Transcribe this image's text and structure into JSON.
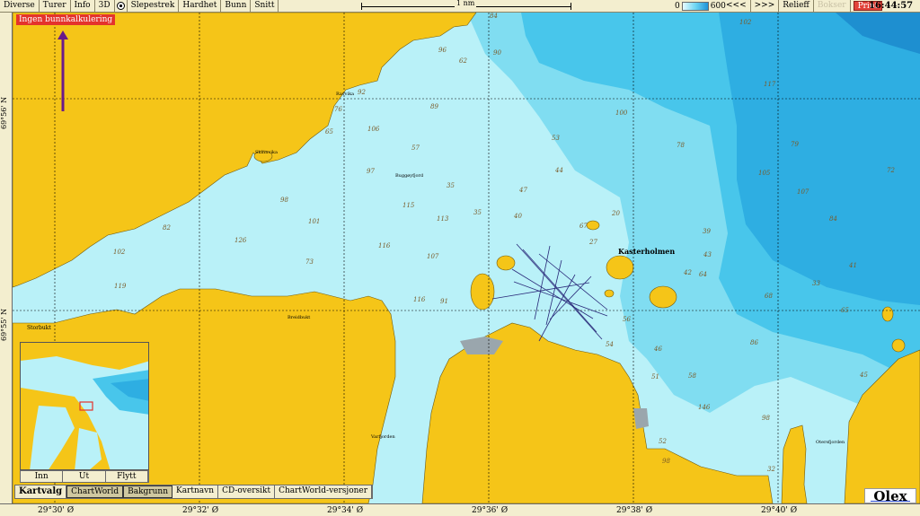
{
  "menu": {
    "items": [
      "Diverse",
      "Turer",
      "Info",
      "3D",
      "Slepestrek",
      "Hardhet",
      "Bunn",
      "Snitt"
    ]
  },
  "scale": {
    "label": "1 nm"
  },
  "depth_legend": {
    "min": "0",
    "max": "600"
  },
  "right_toolbar": {
    "prev": "<<<",
    "next": ">>>",
    "relieff": "Relieff",
    "boxes": "Bokser",
    "print": "Print"
  },
  "clock": "16:44:57",
  "warning": "Ingen bunnkalkulering",
  "latitudes": [
    "69°56' N",
    "69°55' N"
  ],
  "longitudes": [
    "29°30' Ø",
    "29°32' Ø",
    "29°34' Ø",
    "29°36' Ø",
    "29°38' Ø",
    "29°40' Ø"
  ],
  "place_names": {
    "kasterholmen": "Kasterholmen",
    "storbukt": "Storbukt",
    "skinnvika": "Skinnvika",
    "breidbukt": "Breidbukt",
    "ravvika": "Ravvika",
    "buggyfjord": "Buggøyfjord",
    "vartadjorden": "Varfjorden",
    "otersfjorden": "Otersfjorden"
  },
  "depths": [
    "84",
    "92",
    "90",
    "102",
    "76",
    "62",
    "106",
    "96",
    "117",
    "89",
    "98",
    "65",
    "57",
    "53",
    "79",
    "100",
    "97",
    "35",
    "78",
    "105",
    "107",
    "82",
    "115",
    "113",
    "101",
    "126",
    "116",
    "107",
    "47",
    "73",
    "40",
    "116",
    "91",
    "119",
    "102",
    "35",
    "44",
    "43",
    "42",
    "68",
    "64",
    "46",
    "58",
    "56",
    "51",
    "86",
    "146",
    "98",
    "52",
    "54",
    "67",
    "27",
    "20",
    "39",
    "41",
    "33",
    "45",
    "65",
    "32",
    "98",
    "72",
    "84"
  ],
  "minimap": {
    "buttons": [
      "Inn",
      "Ut",
      "Flytt"
    ]
  },
  "chart_bar": {
    "title": "Kartvalg",
    "buttons": [
      "ChartWorld",
      "Bakgrunn",
      "Kartnavn",
      "CD-oversikt",
      "ChartWorld-versjoner"
    ]
  },
  "brand": "Olex",
  "colors": {
    "land": "#f5c518",
    "shallow": "#b8f0f7",
    "mid": "#7fdcf0",
    "deep": "#43c4ea",
    "deeper": "#27a9df",
    "warning_bg": "#e4332c",
    "print_bg": "#e2443a"
  }
}
